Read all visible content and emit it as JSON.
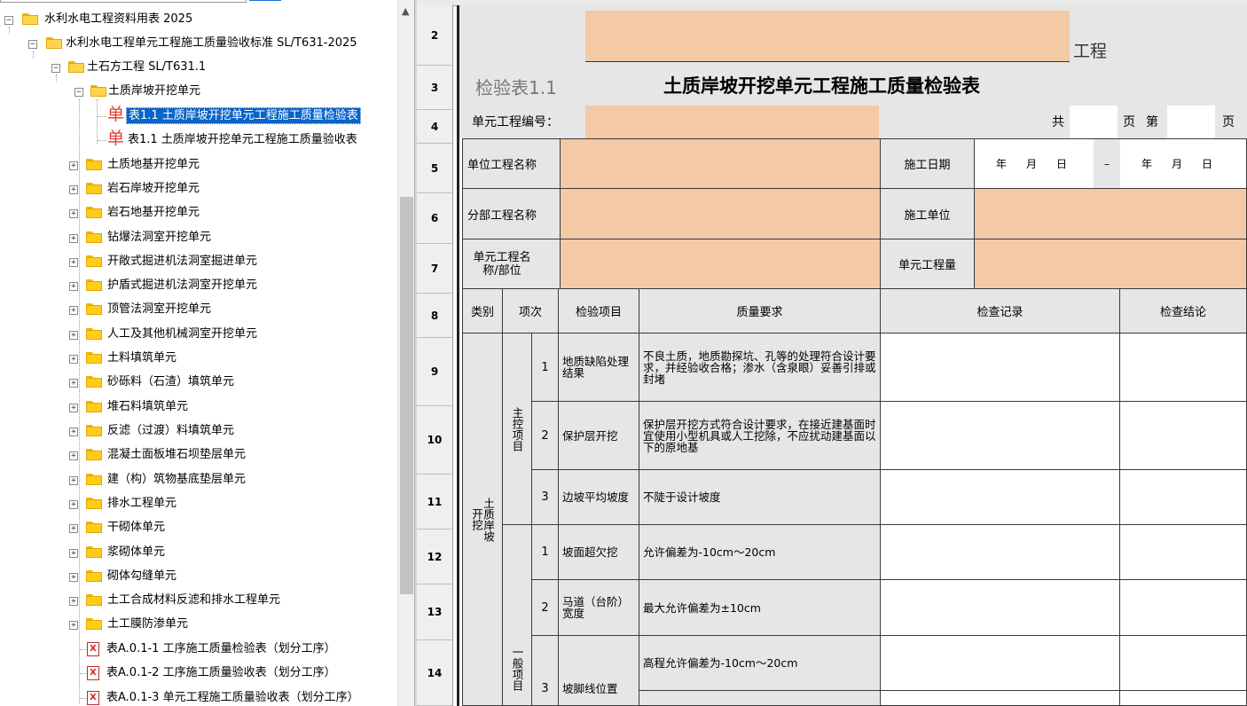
{
  "tree": {
    "items": [
      {
        "label": "水利水电工程资料用表 2025"
      },
      {
        "label": "水利水电工程单元工程施工质量验收标准 SL/T631-2025"
      },
      {
        "label": "土石方工程 SL/T631.1"
      },
      {
        "label": "土质岸坡开挖单元"
      },
      {
        "label": "表1.1 土质岸坡开挖单元工程施工质量检验表"
      },
      {
        "label": "表1.1 土质岸坡开挖单元工程施工质量验收表"
      },
      {
        "label": "土质地基开挖单元"
      },
      {
        "label": "岩石岸坡开挖单元"
      },
      {
        "label": "岩石地基开挖单元"
      },
      {
        "label": "钻爆法洞室开挖单元"
      },
      {
        "label": "开敞式掘进机法洞室掘进单元"
      },
      {
        "label": "护盾式掘进机法洞室开挖单元"
      },
      {
        "label": "顶管法洞室开挖单元"
      },
      {
        "label": "人工及其他机械洞室开挖单元"
      },
      {
        "label": "土料填筑单元"
      },
      {
        "label": "砂砾料（石渣）填筑单元"
      },
      {
        "label": "堆石料填筑单元"
      },
      {
        "label": "反滤（过渡）料填筑单元"
      },
      {
        "label": "混凝土面板堆石坝垫层单元"
      },
      {
        "label": "建（构）筑物基底垫层单元"
      },
      {
        "label": "排水工程单元"
      },
      {
        "label": "干砌体单元"
      },
      {
        "label": "浆砌体单元"
      },
      {
        "label": "砌体勾缝单元"
      },
      {
        "label": "土工合成材料反滤和排水工程单元"
      },
      {
        "label": "土工膜防渗单元"
      },
      {
        "label": "表A.0.1-1 工序施工质量检验表（划分工序）"
      },
      {
        "label": "表A.0.1-2 工序施工质量验收表（划分工序）"
      },
      {
        "label": "表A.0.1-3 单元工程施工质量验收表（划分工序）"
      }
    ],
    "dan_glyph": "单",
    "file_glyph": "X",
    "expand_plus": "+",
    "expand_minus": "−",
    "scroll_up": "▲"
  },
  "sheet": {
    "row_numbers": [
      "2",
      "3",
      "4",
      "5",
      "6",
      "7",
      "8",
      "9",
      "10",
      "11",
      "12",
      "13",
      "14"
    ],
    "project_suffix": "工程",
    "table_no": "检验表1.1",
    "form_title": "土质岸坡开挖单元工程施工质量检验表",
    "unit_code_label": "单元工程编号：",
    "total_label": "共",
    "page_label": "页",
    "page_no_label": "第",
    "page_end_label": "页",
    "unit_project_name": "单位工程名称",
    "construction_date": "施工日期",
    "date_year": "年",
    "date_month": "月",
    "date_day": "日",
    "date_dash": "–",
    "sub_project_name": "分部工程名称",
    "construction_company": "施工单位",
    "unit_work_name": "单元工程名称/部位",
    "unit_work_qty": "单元工程量",
    "headers": {
      "category": "类别",
      "item_no": "项次",
      "check_item": "检验项目",
      "quality_req": "质量要求",
      "check_record": "检查记录",
      "conclusion": "检查结论"
    },
    "category_value": "土质岸坡开挖",
    "main_group": "主控项目",
    "general_group": "一般项目",
    "rows": [
      {
        "no": "1",
        "item": "地质缺陷处理结果",
        "req": "不良土质，地质勘探坑、孔等的处理符合设计要求，并经验收合格；渗水（含泉眼）妥善引排或封堵"
      },
      {
        "no": "2",
        "item": "保护层开挖",
        "req": "保护层开挖方式符合设计要求，在接近建基面时宜使用小型机具或人工挖除，不应扰动建基面以下的原地基"
      },
      {
        "no": "3",
        "item": "边坡平均坡度",
        "req": "不陡于设计坡度"
      },
      {
        "no": "1",
        "item": "坡面超欠挖",
        "req": "允许偏差为-10cm～20cm"
      },
      {
        "no": "2",
        "item": "马道（台阶）宽度",
        "req": "最大允许偏差为±10cm"
      },
      {
        "no": "3",
        "item": "坡脚线位置",
        "req": "高程允许偏差为-10cm～20cm"
      }
    ]
  }
}
